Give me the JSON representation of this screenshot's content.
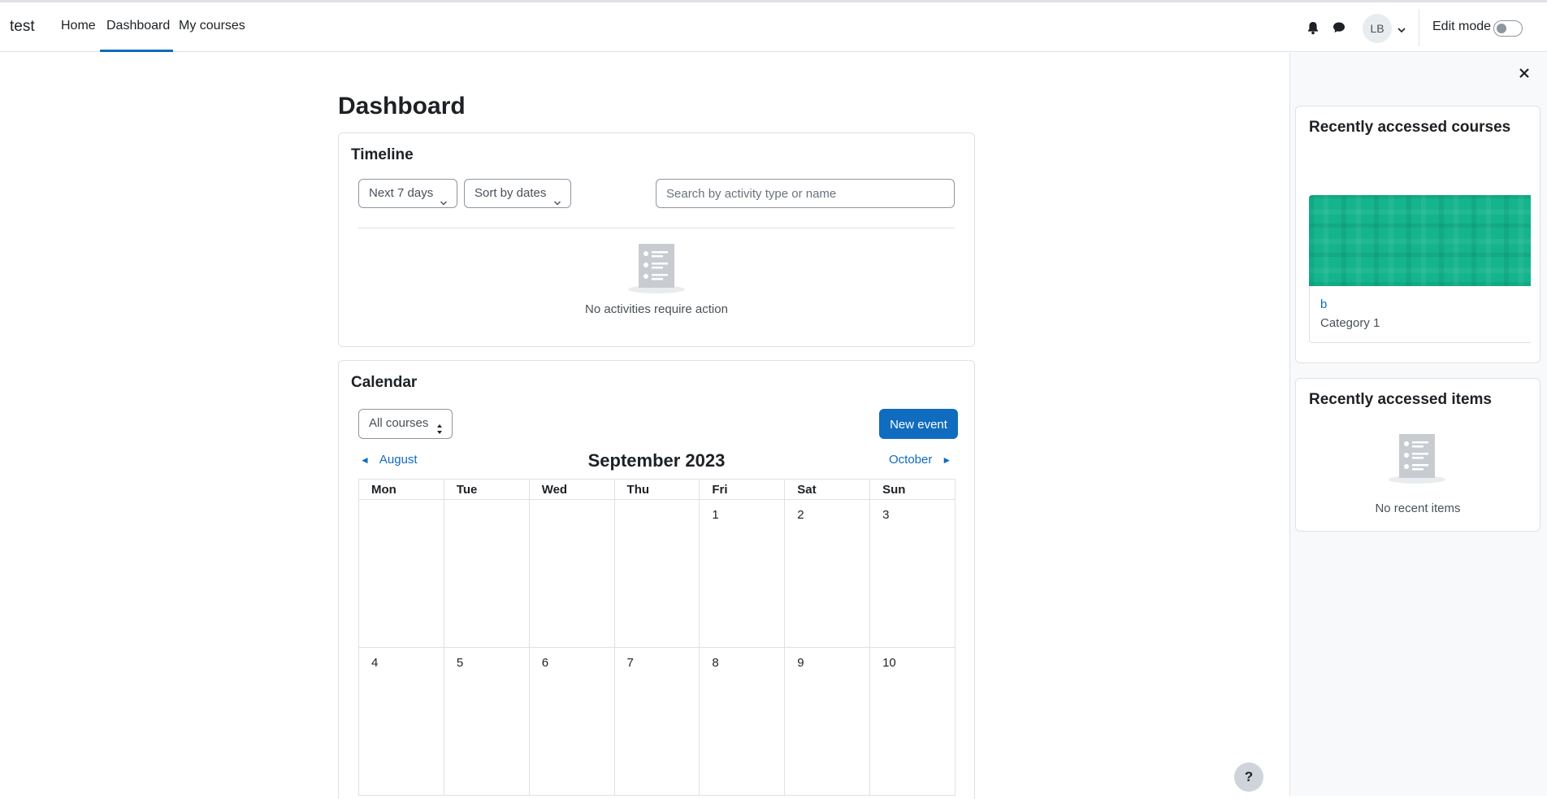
{
  "navbar": {
    "brand": "test",
    "links": [
      {
        "label": "Home"
      },
      {
        "label": "Dashboard",
        "active": true
      },
      {
        "label": "My courses"
      }
    ],
    "avatar_initials": "LB",
    "edit_mode_label": "Edit mode",
    "edit_mode_on": false
  },
  "main": {
    "title": "Dashboard",
    "timeline": {
      "title": "Timeline",
      "filter_label": "Next 7 days",
      "sort_label": "Sort by dates",
      "search_placeholder": "Search by activity type or name",
      "empty_text": "No activities require action"
    },
    "calendar": {
      "title": "Calendar",
      "course_filter": "All courses",
      "new_event_label": "New event",
      "prev_month": "August",
      "next_month": "October",
      "current_month": "September 2023",
      "weekdays": [
        "Mon",
        "Tue",
        "Wed",
        "Thu",
        "Fri",
        "Sat",
        "Sun"
      ],
      "weeks": [
        [
          "",
          "",
          "",
          "",
          "1",
          "2",
          "3"
        ],
        [
          "4",
          "5",
          "6",
          "7",
          "8",
          "9",
          "10"
        ]
      ]
    }
  },
  "drawer": {
    "recent_courses": {
      "title": "Recently accessed courses",
      "course_name": "b",
      "course_category": "Category 1"
    },
    "recent_items": {
      "title": "Recently accessed items",
      "empty_text": "No recent items"
    }
  },
  "help_label": "?",
  "colors": {
    "accent": "#0f6cbf",
    "course_image": "#15b48c"
  }
}
